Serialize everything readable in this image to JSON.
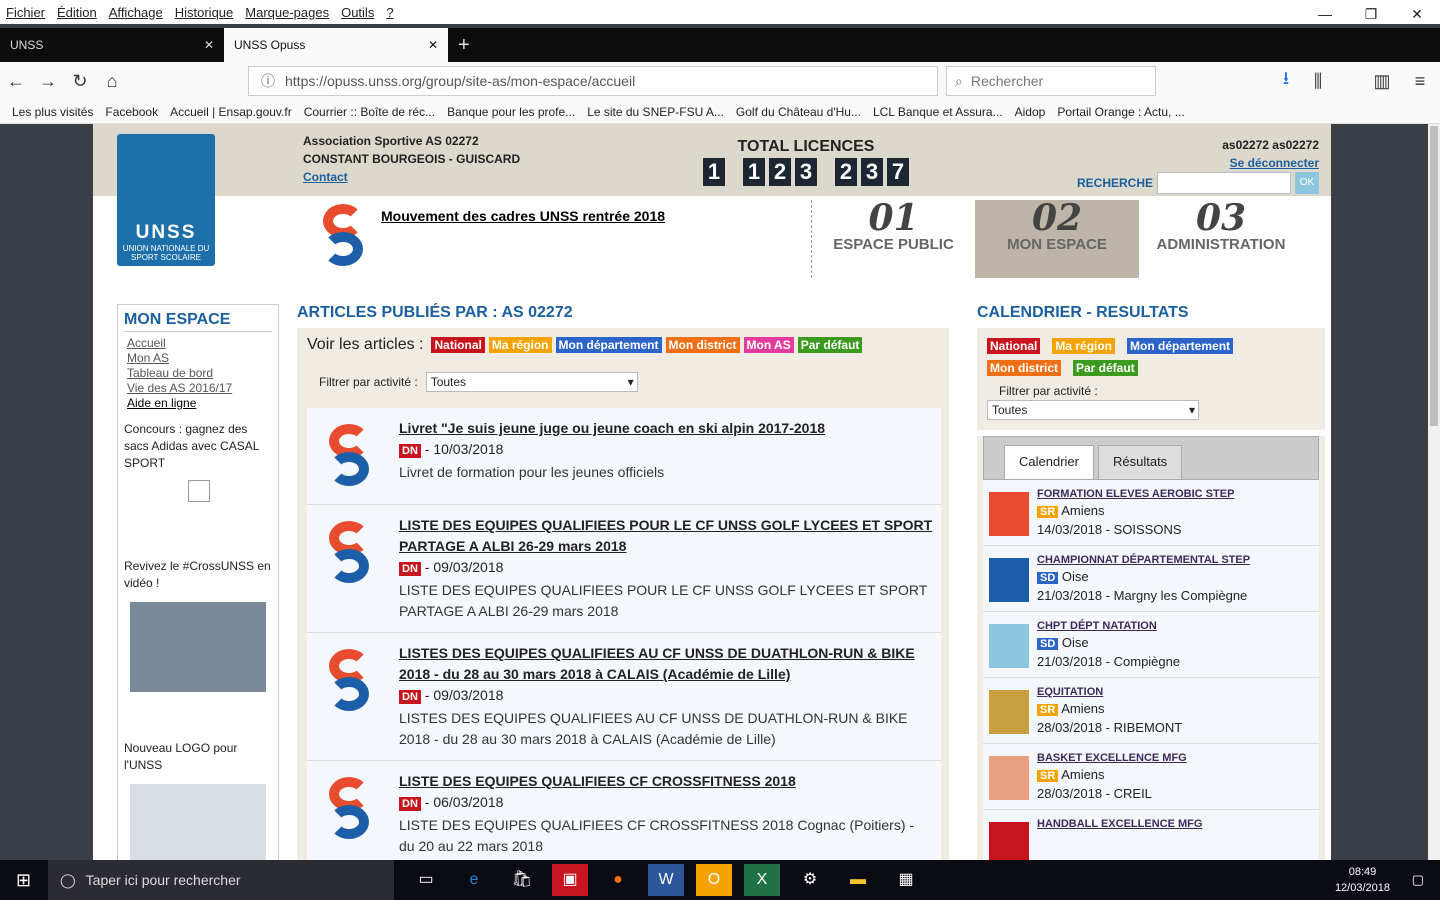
{
  "menubar": [
    "Fichier",
    "Édition",
    "Affichage",
    "Historique",
    "Marque-pages",
    "Outils",
    "?"
  ],
  "window_controls": [
    "—",
    "❐",
    "✕"
  ],
  "tabs": [
    {
      "label": "UNSS",
      "active": false
    },
    {
      "label": "UNSS Opuss",
      "active": true
    }
  ],
  "nav": {
    "url": "https://opuss.unss.org/group/site-as/mon-espace/accueil",
    "search_placeholder": "Rechercher"
  },
  "bookmarks": [
    "Les plus visités",
    "Facebook",
    "Accueil | Ensap.gouv.fr",
    "Courrier :: Boîte de réc...",
    "Banque pour les profe...",
    "Le site du SNEP-FSU A...",
    "Golf du Château d'Hu...",
    "LCL Banque et Assura...",
    "Aidop",
    "Portail Orange : Actu, ..."
  ],
  "header": {
    "assoc_line1": "Association Sportive AS 02272",
    "assoc_line2": "CONSTANT BOURGEOIS - GUISCARD",
    "contact": "Contact",
    "licences_title": "TOTAL LICENCES",
    "licences_digits": [
      "1",
      "1",
      "2",
      "3",
      "2",
      "3",
      "7"
    ],
    "user": "as02272 as02272",
    "logout": "Se déconnecter",
    "search_label": "RECHERCHE",
    "search_ok": "OK"
  },
  "logo": {
    "name": "UNSS",
    "subtitle": "UNION NATIONALE DU SPORT SCOLAIRE"
  },
  "news_title": "Mouvement des cadres UNSS rentrée 2018",
  "spaces": [
    {
      "num": "01",
      "label": "ESPACE PUBLIC"
    },
    {
      "num": "02",
      "label": "MON ESPACE"
    },
    {
      "num": "03",
      "label": "ADMINISTRATION"
    }
  ],
  "sidebar": {
    "title": "MON ESPACE",
    "links": [
      "Accueil",
      "Mon AS",
      "Tableau de bord",
      "Vie des AS 2016/17",
      "Aide en ligne"
    ],
    "promo1": "Concours : gagnez des sacs Adidas avec CASAL SPORT",
    "promo2": "Revivez le #CrossUNSS en vidéo !",
    "promo3": "Nouveau LOGO pour l'UNSS"
  },
  "articles": {
    "heading": "ARTICLES PUBLIÉS PAR : AS 02272",
    "voir_label": "Voir les articles :",
    "tags": [
      {
        "label": "National",
        "color": "#c8141e"
      },
      {
        "label": "Ma région",
        "color": "#f4a300"
      },
      {
        "label": "Mon département",
        "color": "#2c64c8"
      },
      {
        "label": "Mon district",
        "color": "#f06e14"
      },
      {
        "label": "Mon AS",
        "color": "#e43c9c"
      },
      {
        "label": "Par défaut",
        "color": "#3c9a1e"
      }
    ],
    "filter_label": "Filtrer par activité :",
    "filter_value": "Toutes",
    "items": [
      {
        "title": "Livret \"Je suis jeune juge ou jeune coach en ski alpin 2017-2018",
        "badge": "DN",
        "date": "- 10/03/2018",
        "desc": "Livret de formation pour les jeunes officiels"
      },
      {
        "title": "LISTE DES EQUIPES QUALIFIEES POUR LE CF UNSS GOLF LYCEES ET SPORT PARTAGE A ALBI 26-29 mars 2018",
        "badge": "DN",
        "date": "- 09/03/2018",
        "desc": "LISTE DES EQUIPES QUALIFIEES POUR LE CF UNSS GOLF LYCEES ET SPORT PARTAGE A ALBI 26-29 mars 2018"
      },
      {
        "title": "LISTES DES EQUIPES QUALIFIEES AU CF UNSS DE DUATHLON-RUN & BIKE 2018 - du 28 au 30 mars 2018 à CALAIS (Académie de Lille)",
        "badge": "DN",
        "date": "- 09/03/2018",
        "desc": "LISTES DES EQUIPES QUALIFIEES AU CF UNSS DE DUATHLON-RUN & BIKE 2018 - du 28 au 30 mars 2018 à CALAIS (Académie de Lille)"
      },
      {
        "title": "LISTE DES EQUIPES QUALIFIEES CF CROSSFITNESS 2018",
        "badge": "DN",
        "date": "- 06/03/2018",
        "desc": "LISTE DES EQUIPES QUALIFIEES CF CROSSFITNESS 2018 Cognac (Poitiers) - du 20 au 22 mars 2018"
      }
    ]
  },
  "calendar": {
    "heading": "CALENDRIER - RESULTATS",
    "tags": [
      {
        "label": "National",
        "color": "#c8141e"
      },
      {
        "label": "Ma région",
        "color": "#f4a300"
      },
      {
        "label": "Mon département",
        "color": "#2c64c8"
      },
      {
        "label": "Mon district",
        "color": "#f06e14"
      },
      {
        "label": "Par défaut",
        "color": "#3c9a1e"
      }
    ],
    "filter_label": "Filtrer par activité :",
    "filter_value": "Toutes",
    "tab_on": "Calendrier",
    "tab_off": "Résultats",
    "events": [
      {
        "title": "FORMATION ELEVES AEROBIC STEP",
        "badge": "SR",
        "place": "Amiens",
        "date": "14/03/2018 - SOISSONS"
      },
      {
        "title": "CHAMPIONNAT DÉPARTEMENTAL STEP",
        "badge": "SD",
        "place": "Oise",
        "date": "21/03/2018 - Margny les Compiègne"
      },
      {
        "title": "CHPT DÉPT NATATION",
        "badge": "SD",
        "place": "Oise",
        "date": "21/03/2018 - Compiègne"
      },
      {
        "title": "EQUITATION",
        "badge": "SR",
        "place": "Amiens",
        "date": "28/03/2018 - RIBEMONT"
      },
      {
        "title": "BASKET EXCELLENCE MFG",
        "badge": "SR",
        "place": "Amiens",
        "date": "28/03/2018 - CREIL"
      },
      {
        "title": "HANDBALL EXCELLENCE MFG",
        "badge": "",
        "place": "",
        "date": ""
      }
    ]
  },
  "taskbar": {
    "search_placeholder": "Taper ici pour rechercher",
    "time": "08:49",
    "date": "12/03/2018"
  }
}
